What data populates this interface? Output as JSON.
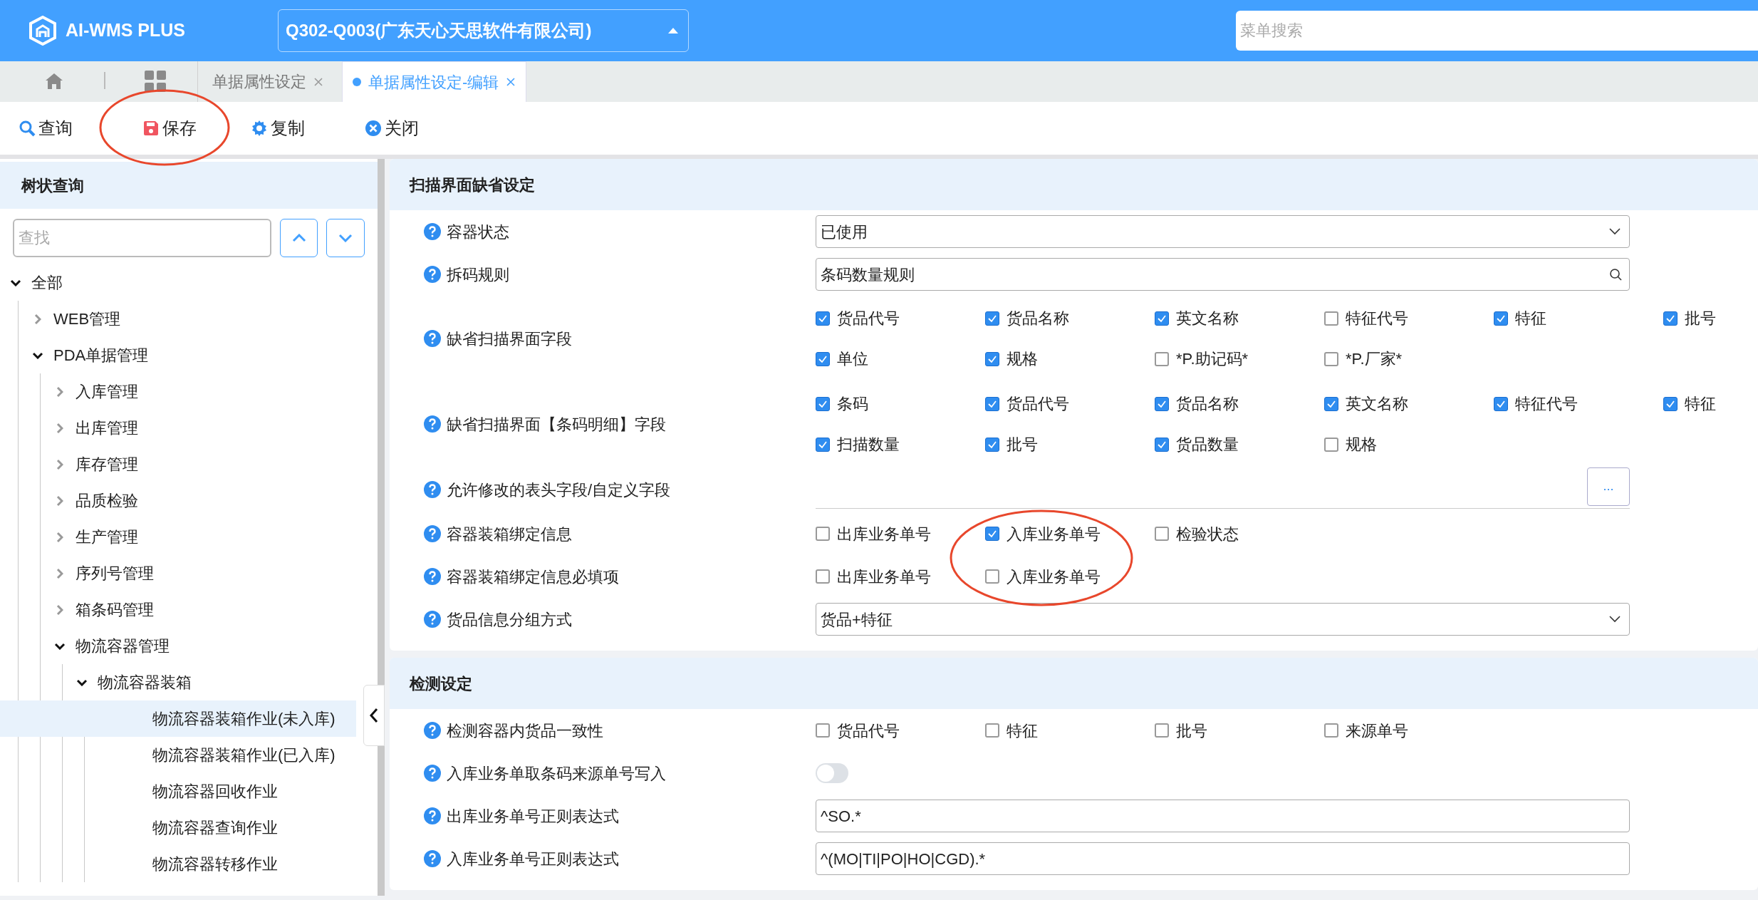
{
  "header": {
    "app_name": "AI-WMS PLUS",
    "company": "Q302-Q003(广东天心天思软件有限公司)",
    "search": {
      "placeholder": "菜单搜索"
    }
  },
  "tabs": [
    {
      "label": "单据属性设定",
      "selected": false
    },
    {
      "label": "单据属性设定-编辑",
      "selected": true
    }
  ],
  "toolbar": [
    {
      "kind": "search",
      "label": "查询"
    },
    {
      "kind": "save",
      "label": "保存"
    },
    {
      "kind": "copy",
      "label": "复制"
    },
    {
      "kind": "close",
      "label": "关闭"
    }
  ],
  "tree_panel": {
    "title": "树状查询",
    "search": {
      "placeholder": "查找"
    },
    "items": [
      {
        "label": "全部",
        "expanded": true,
        "selected": false,
        "children": [
          {
            "label": "WEB管理",
            "expanded": false,
            "selected": false
          },
          {
            "label": "PDA单据管理",
            "expanded": true,
            "selected": false,
            "children": [
              {
                "label": "入库管理",
                "expanded": false,
                "selected": false
              },
              {
                "label": "出库管理",
                "expanded": false,
                "selected": false
              },
              {
                "label": "库存管理",
                "expanded": false,
                "selected": false
              },
              {
                "label": "品质检验",
                "expanded": false,
                "selected": false
              },
              {
                "label": "生产管理",
                "expanded": false,
                "selected": false
              },
              {
                "label": "序列号管理",
                "expanded": false,
                "selected": false
              },
              {
                "label": "箱条码管理",
                "expanded": false,
                "selected": false
              },
              {
                "label": "物流容器管理",
                "expanded": true,
                "selected": false,
                "children": [
                  {
                    "label": "物流容器装箱",
                    "expanded": true,
                    "selected": false,
                    "children": [
                      {
                        "label": "物流容器装箱作业(未入库)",
                        "selected": true
                      },
                      {
                        "label": "物流容器装箱作业(已入库)",
                        "selected": false
                      },
                      {
                        "label": "物流容器回收作业",
                        "selected": false
                      },
                      {
                        "label": "物流容器查询作业",
                        "selected": false
                      },
                      {
                        "label": "物流容器转移作业",
                        "selected": false
                      }
                    ]
                  }
                ]
              }
            ]
          }
        ]
      }
    ]
  },
  "sections": [
    {
      "title": "扫描界面缺省设定",
      "rows": [
        {
          "kind": "select",
          "label": "容器状态",
          "value": "已使用"
        },
        {
          "kind": "lookup",
          "label": "拆码规则",
          "value": "条码数量规则"
        },
        {
          "kind": "checks",
          "label": "缺省扫描界面字段",
          "options": [
            {
              "label": "货品代号",
              "checked": true
            },
            {
              "label": "货品名称",
              "checked": true
            },
            {
              "label": "英文名称",
              "checked": true
            },
            {
              "label": "特征代号",
              "checked": false
            },
            {
              "label": "特征",
              "checked": true
            },
            {
              "label": "批号",
              "checked": true
            },
            {
              "label": "单位",
              "checked": true
            },
            {
              "label": "规格",
              "checked": true
            },
            {
              "label": "*P.助记码*",
              "checked": false
            },
            {
              "label": "*P.厂家*",
              "checked": false
            }
          ]
        },
        {
          "kind": "checks",
          "label": "缺省扫描界面【条码明细】字段",
          "options": [
            {
              "label": "条码",
              "checked": true
            },
            {
              "label": "货品代号",
              "checked": true
            },
            {
              "label": "货品名称",
              "checked": true
            },
            {
              "label": "英文名称",
              "checked": true
            },
            {
              "label": "特征代号",
              "checked": true
            },
            {
              "label": "特征",
              "checked": true
            },
            {
              "label": "扫描数量",
              "checked": true
            },
            {
              "label": "批号",
              "checked": true
            },
            {
              "label": "货品数量",
              "checked": true
            },
            {
              "label": "规格",
              "checked": false
            }
          ]
        },
        {
          "kind": "picker",
          "label": "允许修改的表头字段/自定义字段",
          "button": "..."
        },
        {
          "kind": "checks",
          "label": "容器装箱绑定信息",
          "options": [
            {
              "label": "出库业务单号",
              "checked": false
            },
            {
              "label": "入库业务单号",
              "checked": true
            },
            {
              "label": "检验状态",
              "checked": false
            }
          ]
        },
        {
          "kind": "checks",
          "label": "容器装箱绑定信息必填项",
          "options": [
            {
              "label": "出库业务单号",
              "checked": false
            },
            {
              "label": "入库业务单号",
              "checked": false
            }
          ]
        },
        {
          "kind": "select",
          "label": "货品信息分组方式",
          "value": "货品+特征"
        }
      ]
    },
    {
      "title": "检测设定",
      "rows": [
        {
          "kind": "checks",
          "label": "检测容器内货品一致性",
          "options": [
            {
              "label": "货品代号",
              "checked": false
            },
            {
              "label": "特征",
              "checked": false
            },
            {
              "label": "批号",
              "checked": false
            },
            {
              "label": "来源单号",
              "checked": false
            }
          ]
        },
        {
          "kind": "toggle",
          "label": "入库业务单取条码来源单号写入",
          "on": false
        },
        {
          "kind": "text",
          "label": "出库业务单号正则表达式",
          "value": "^SO.*"
        },
        {
          "kind": "text",
          "label": "入库业务单号正则表达式",
          "value": "^(MO|TI|PO|HO|CGD).*"
        }
      ]
    }
  ]
}
